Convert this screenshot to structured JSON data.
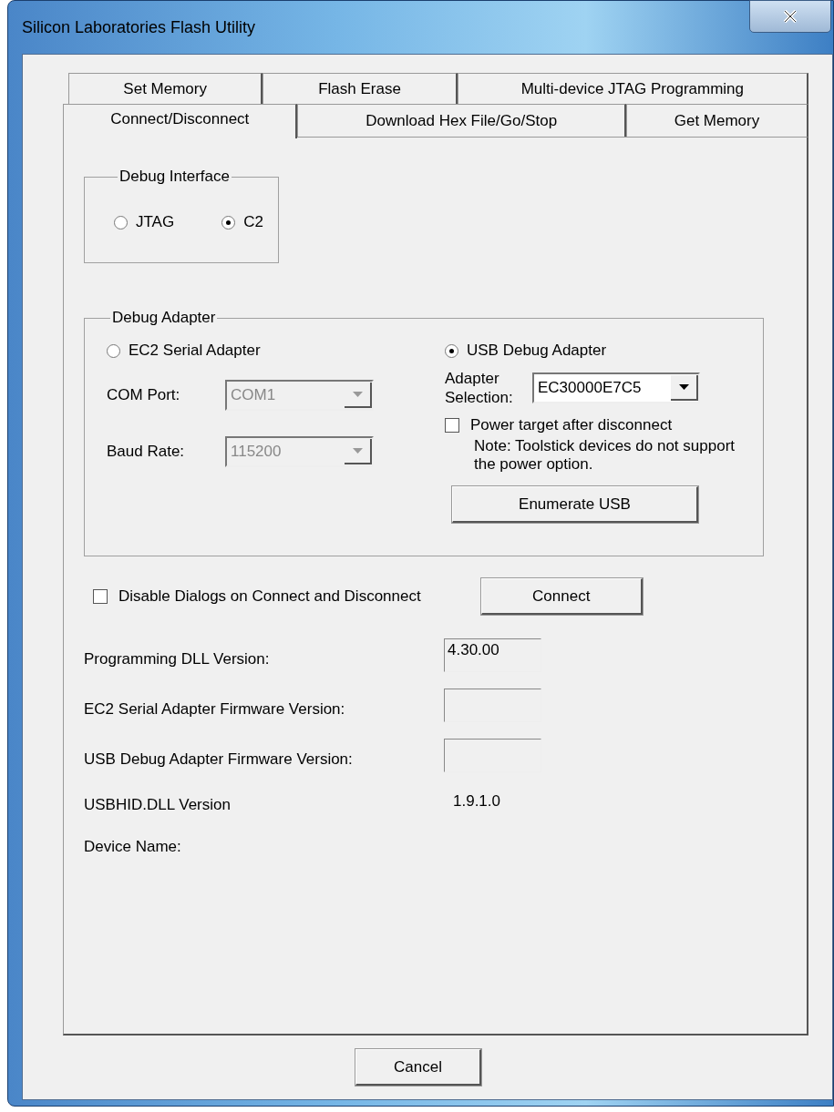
{
  "window": {
    "title": "Silicon Laboratories Flash Utility"
  },
  "tab_rows": [
    {
      "tabs": [
        {
          "label": "Set Memory",
          "selected": false
        },
        {
          "label": "Flash Erase",
          "selected": false
        },
        {
          "label": "Multi-device JTAG Programming",
          "selected": false
        }
      ]
    },
    {
      "tabs": [
        {
          "label": "Connect/Disconnect",
          "selected": true
        },
        {
          "label": "Download Hex File/Go/Stop",
          "selected": false
        },
        {
          "label": "Get Memory",
          "selected": false
        }
      ]
    }
  ],
  "debug_interface": {
    "title": "Debug Interface",
    "options": [
      {
        "label": "JTAG",
        "selected": false
      },
      {
        "label": "C2",
        "selected": true
      }
    ]
  },
  "debug_adapter": {
    "title": "Debug Adapter",
    "serial": {
      "label": "EC2 Serial Adapter",
      "selected": false,
      "com_port": {
        "label": "COM Port:",
        "value": "COM1",
        "disabled": true
      },
      "baud_rate": {
        "label": "Baud Rate:",
        "value": "115200",
        "disabled": true
      }
    },
    "usb": {
      "label": "USB Debug Adapter",
      "selected": true,
      "adapter_selection": {
        "label": "Adapter Selection:",
        "value": "EC30000E7C5",
        "disabled": false
      },
      "power_checkbox": {
        "label": "Power target after disconnect",
        "checked": false
      },
      "note": "Note: Toolstick devices do not support the power option.",
      "enumerate_button": "Enumerate USB"
    }
  },
  "disable_dialogs": {
    "label": "Disable Dialogs on Connect and Disconnect",
    "checked": false
  },
  "connect_button": "Connect",
  "info_rows": [
    {
      "label": "Programming DLL Version:",
      "kind": "field",
      "value": "4.30.00"
    },
    {
      "label": "EC2 Serial Adapter Firmware Version:",
      "kind": "field"
    },
    {
      "label": "USB Debug Adapter Firmware Version:",
      "kind": "field"
    },
    {
      "label": "USBHID.DLL Version",
      "kind": "text",
      "value": "1.9.1.0"
    },
    {
      "label": "Device Name:",
      "kind": "none"
    }
  ],
  "cancel_button": "Cancel"
}
